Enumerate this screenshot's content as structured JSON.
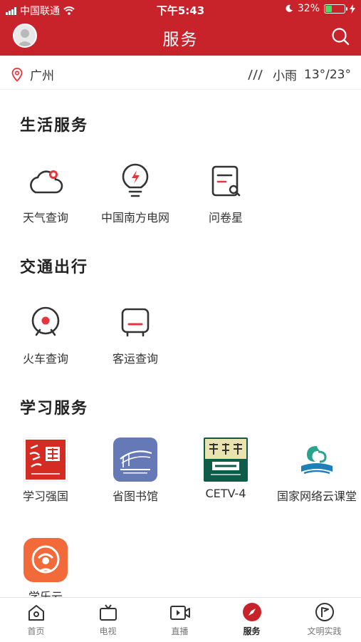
{
  "status_bar": {
    "carrier": "中国联通",
    "time": "下午5:43",
    "battery": "32%",
    "battery_level": 0.32
  },
  "header": {
    "title": "服务"
  },
  "location_bar": {
    "city": "广州",
    "weather": "小雨",
    "temperature": "13°/23°"
  },
  "sections": [
    {
      "title": "生活服务",
      "items": [
        {
          "label": "天气查询",
          "icon": "cloud-icon"
        },
        {
          "label": "中国南方电网",
          "icon": "lightbulb-icon"
        },
        {
          "label": "问卷星",
          "icon": "survey-icon"
        }
      ]
    },
    {
      "title": "交通出行",
      "items": [
        {
          "label": "火车查询",
          "icon": "train-icon"
        },
        {
          "label": "客运查询",
          "icon": "bus-icon"
        }
      ]
    },
    {
      "title": "学习服务",
      "items": [
        {
          "label": "学习强国",
          "icon": "xuexiqiangguo-logo"
        },
        {
          "label": "省图书馆",
          "icon": "library-logo"
        },
        {
          "label": "CETV-4",
          "icon": "cetv4-logo"
        },
        {
          "label": "国家网络云课堂",
          "icon": "cloud-classroom-logo"
        },
        {
          "label": "学乐云",
          "icon": "xueleyun-logo"
        }
      ]
    }
  ],
  "tabs": [
    {
      "label": "首页",
      "icon": "home-icon"
    },
    {
      "label": "电视",
      "icon": "tv-icon"
    },
    {
      "label": "直播",
      "icon": "live-icon"
    },
    {
      "label": "服务",
      "icon": "compass-icon",
      "active": true
    },
    {
      "label": "文明实践",
      "icon": "flag-icon"
    }
  ],
  "colors": {
    "brand_red": "#c8232a",
    "icon_accent": "#e8343b"
  }
}
